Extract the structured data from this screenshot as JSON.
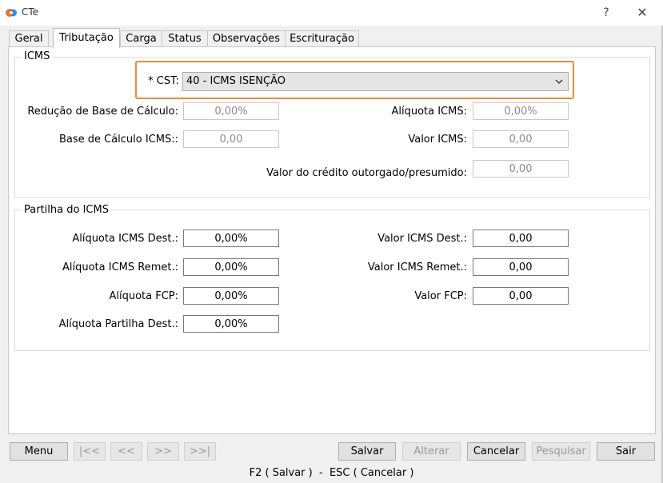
{
  "window": {
    "title": "CTe",
    "help": "?",
    "close": "✕"
  },
  "tabs": [
    {
      "label": "Geral"
    },
    {
      "label": "Tributação"
    },
    {
      "label": "Carga"
    },
    {
      "label": "Status"
    },
    {
      "label": "Observações"
    },
    {
      "label": "Escrituração"
    }
  ],
  "icms": {
    "title": "ICMS",
    "cst_label": "* CST:",
    "cst_value": "40 - ICMS ISENÇÃO",
    "reducao_label": "Redução de Base de Cálculo:",
    "reducao_value": "0,00%",
    "aliquota_label": "Alíquota ICMS:",
    "aliquota_value": "0,00%",
    "base_label": "Base de Cálculo ICMS::",
    "base_value": "0,00",
    "valor_label": "Valor ICMS:",
    "valor_value": "0,00",
    "credito_label": "Valor do crédito outorgado/presumido:",
    "credito_value": "0,00"
  },
  "partilha": {
    "title": "Partilha do ICMS",
    "aliq_dest_label": "Alíquota ICMS Dest.:",
    "aliq_dest_value": "0,00%",
    "valor_dest_label": "Valor ICMS Dest.:",
    "valor_dest_value": "0,00",
    "aliq_remet_label": "Alíquota ICMS Remet.:",
    "aliq_remet_value": "0,00%",
    "valor_remet_label": "Valor ICMS Remet.:",
    "valor_remet_value": "0,00",
    "aliq_fcp_label": "Alíquota FCP:",
    "aliq_fcp_value": "0,00%",
    "valor_fcp_label": "Valor FCP:",
    "valor_fcp_value": "0,00",
    "aliq_partilha_label": "Alíquota Partilha Dest.:",
    "aliq_partilha_value": "0,00%"
  },
  "buttons": {
    "menu": "Menu",
    "first": "|<<",
    "prev": "<<",
    "next": ">>",
    "last": ">>|",
    "salvar": "Salvar",
    "alterar": "Alterar",
    "cancelar": "Cancelar",
    "pesquisar": "Pesquisar",
    "sair": "Sair"
  },
  "status_text": "F2 ( Salvar )  -  ESC ( Cancelar )",
  "colors": {
    "highlight": "#f08a33",
    "accent_orange": "#e8772e",
    "accent_blue": "#2f7dd1"
  }
}
